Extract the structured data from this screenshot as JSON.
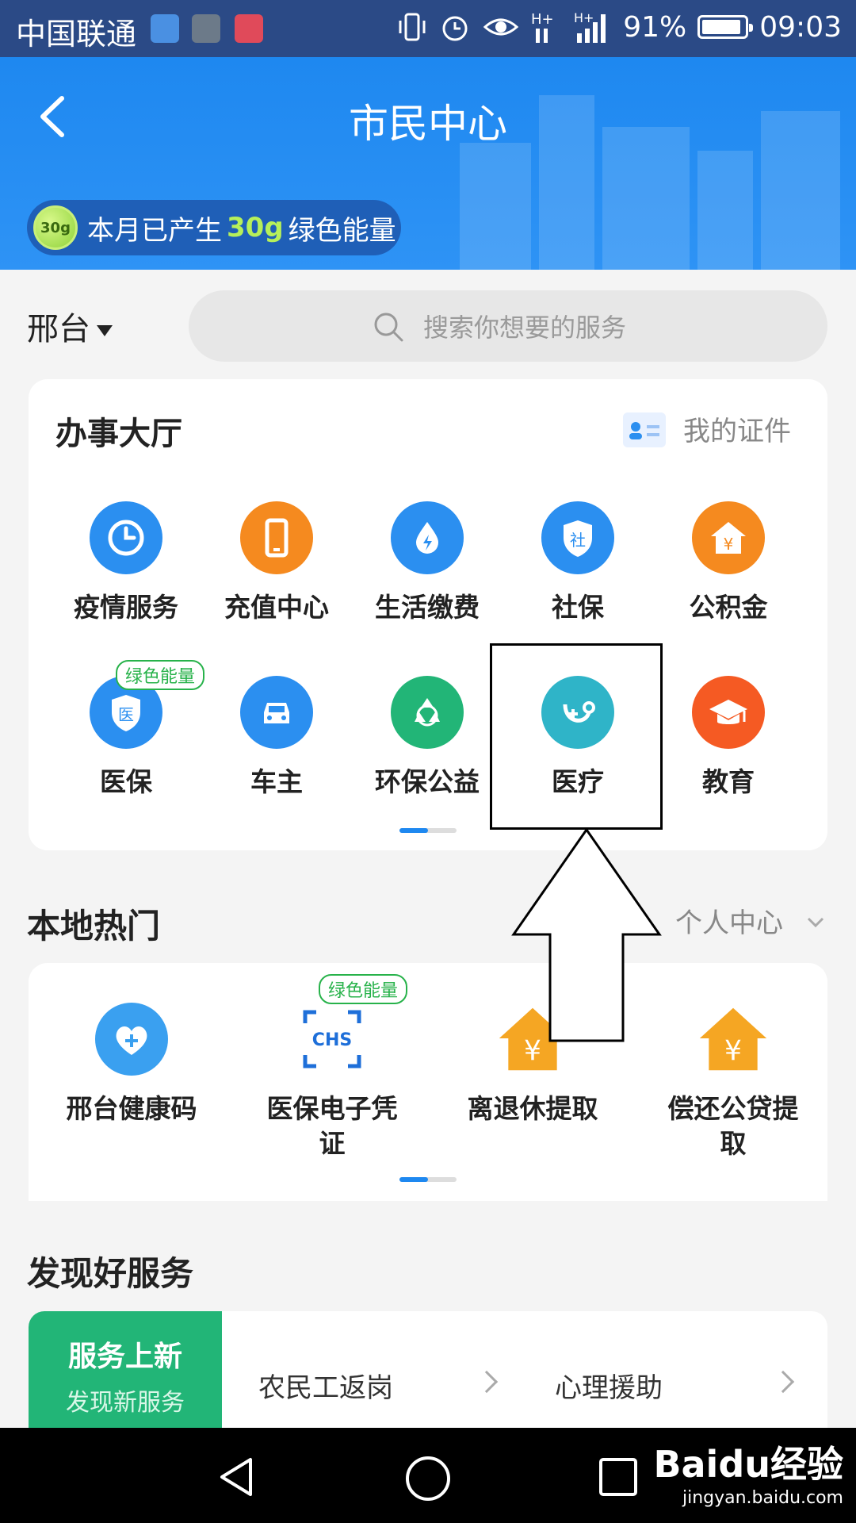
{
  "status_bar": {
    "carrier": "中国联通",
    "battery": "91%",
    "battery_level": 0.91,
    "time": "09:03",
    "app_icon_colors": [
      "#4a90e2",
      "#6c7a89",
      "#e04a5a"
    ]
  },
  "header": {
    "title": "市民中心",
    "energy_ball": "30g",
    "energy_prefix": "本月已产生",
    "energy_amount": "30g",
    "energy_suffix": "绿色能量",
    "colors": {
      "bg": "#1e88f0",
      "pill": "#1f5fb7",
      "amount": "#b6f05a"
    }
  },
  "location": "邢台",
  "search": {
    "placeholder": "搜索你想要的服务"
  },
  "hall": {
    "title": "办事大厅",
    "link": "我的证件",
    "services": [
      {
        "label": "疫情服务",
        "icon": "clock-refresh-icon",
        "color": "#2b8ff0"
      },
      {
        "label": "充值中心",
        "icon": "phone-icon",
        "color": "#f58a1f"
      },
      {
        "label": "生活缴费",
        "icon": "water-bolt-icon",
        "color": "#2b8ff0"
      },
      {
        "label": "社保",
        "icon": "shield-she-icon",
        "color": "#2b8ff0",
        "glyph": "社"
      },
      {
        "label": "公积金",
        "icon": "house-yuan-icon",
        "color": "#f58a1f",
        "glyph": "¥"
      },
      {
        "label": "医保",
        "icon": "shield-yi-icon",
        "color": "#2b8ff0",
        "glyph": "医",
        "badge": "绿色能量"
      },
      {
        "label": "车主",
        "icon": "car-icon",
        "color": "#2b8ff0"
      },
      {
        "label": "环保公益",
        "icon": "recycle-icon",
        "color": "#22b577"
      },
      {
        "label": "医疗",
        "icon": "stethoscope-icon",
        "color": "#2fb4c8"
      },
      {
        "label": "教育",
        "icon": "graduation-cap-icon",
        "color": "#f55a23"
      }
    ]
  },
  "hot": {
    "title": "本地热门",
    "link": "个人中心",
    "services": [
      {
        "label_lines": [
          "邢台健康码"
        ],
        "icon": "heart-plus-icon",
        "color": "#3aa0f0"
      },
      {
        "label_lines": [
          "医保电子凭",
          "证"
        ],
        "icon": "chs-scan-icon",
        "color": "#1e6fd9",
        "badge": "绿色能量",
        "glyph": "CHS"
      },
      {
        "label_lines": [
          "离退休提取"
        ],
        "icon": "house-yuan-icon",
        "color": "#f5a623",
        "glyph": "¥"
      },
      {
        "label_lines": [
          "偿还公贷提",
          "取"
        ],
        "icon": "house-yuan-icon",
        "color": "#f5a623",
        "glyph": "¥"
      }
    ]
  },
  "discover": {
    "title": "发现好服务",
    "new_title": "服务上新",
    "new_sub": "发现新服务",
    "items": [
      "农民工返岗",
      "心理援助"
    ]
  },
  "watermark": {
    "line1": "Baidu经验",
    "line2": "jingyan.baidu.com"
  }
}
